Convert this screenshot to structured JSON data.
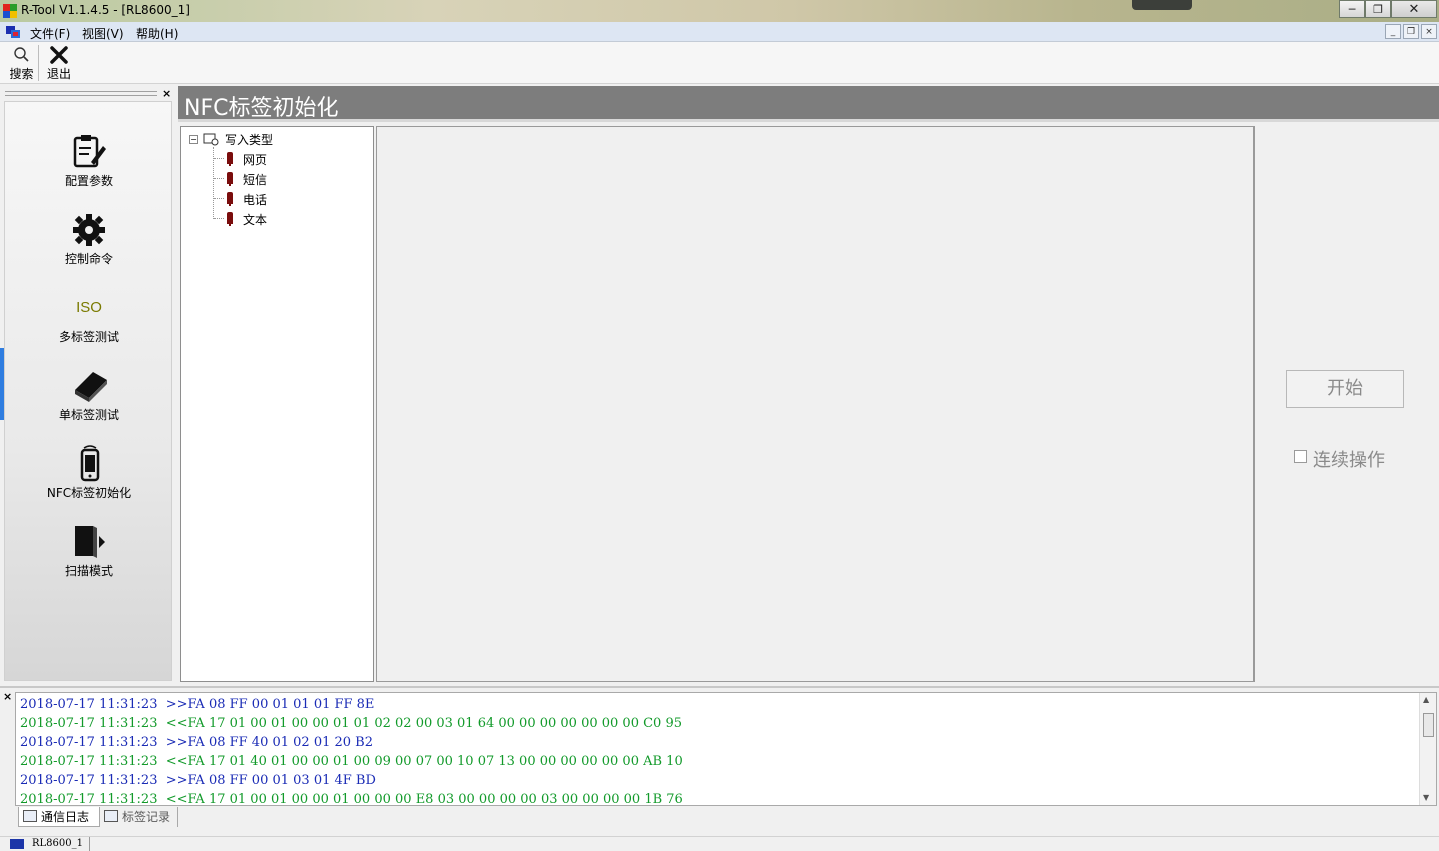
{
  "window": {
    "title": "R-Tool V1.1.4.5 - [RL8600_1]",
    "minimize": "─",
    "maximize": "❐",
    "close": "✕"
  },
  "menu": {
    "items": [
      "文件(F)",
      "视图(V)",
      "帮助(H)"
    ],
    "mdi_minimize": "_",
    "mdi_restore": "❐",
    "mdi_close": "×"
  },
  "toolbar": {
    "search_label": "搜索",
    "exit_label": "退出"
  },
  "nav": {
    "items": [
      {
        "label": "配置参数",
        "icon": "config-icon"
      },
      {
        "label": "控制命令",
        "icon": "gear-icon"
      },
      {
        "label": "多标签测试",
        "icon": "iso-icon",
        "icon_text": "ISO"
      },
      {
        "label": "单标签测试",
        "icon": "book-icon"
      },
      {
        "label": "NFC标签初始化",
        "icon": "phone-icon"
      },
      {
        "label": "扫描模式",
        "icon": "door-exit-icon"
      }
    ],
    "active_index": 4,
    "active_color": "#2f7de0"
  },
  "content": {
    "title": "NFC标签初始化",
    "tree_root": "写入类型",
    "tree_children": [
      "网页",
      "短信",
      "电话",
      "文本"
    ],
    "start_button": "开始",
    "continuous_label": "连续操作",
    "continuous_checked": false
  },
  "log": {
    "lines": [
      {
        "time": "2018-07-17 11:31:23",
        "dir": "tx",
        "text": ">>FA 08 FF 00 01 01 01 FF 8E"
      },
      {
        "time": "2018-07-17 11:31:23",
        "dir": "rx",
        "text": "<<FA 17 01 00 01 00 00 01 01 02 02 00 03 01 64 00 00 00 00 00 00 00 C0 95"
      },
      {
        "time": "2018-07-17 11:31:23",
        "dir": "tx",
        "text": ">>FA 08 FF 40 01 02 01 20 B2"
      },
      {
        "time": "2018-07-17 11:31:23",
        "dir": "rx",
        "text": "<<FA 17 01 40 01 00 00 01 00 09 00 07 00 10 07 13 00 00 00 00 00 00 AB 10"
      },
      {
        "time": "2018-07-17 11:31:23",
        "dir": "tx",
        "text": ">>FA 08 FF 00 01 03 01 4F BD"
      },
      {
        "time": "2018-07-17 11:31:23",
        "dir": "rx",
        "text": "<<FA 17 01 00 01 00 00 01 00 00 00 E8 03 00 00 00 00 03 00 00 00 00 1B 76"
      }
    ],
    "tx_color": "#1a2bb5",
    "rx_color": "#129a2a"
  },
  "tabs": [
    "通信日志",
    "标签记录"
  ],
  "status": {
    "device": "RL8600_1"
  }
}
